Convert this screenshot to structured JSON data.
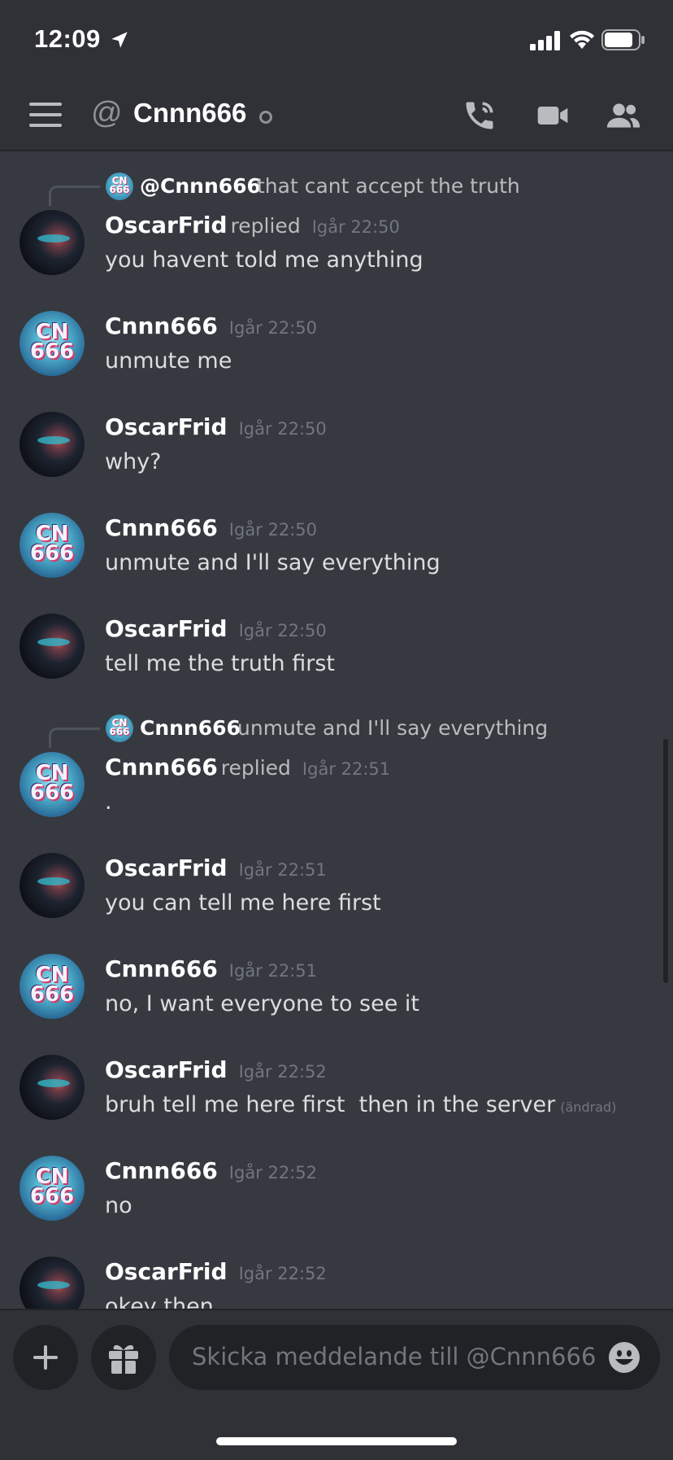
{
  "status_bar": {
    "time": "12:09"
  },
  "header": {
    "channel_name": "Cnnn666",
    "prefix": "@"
  },
  "messages": [
    {
      "reply": {
        "name": "@Cnnn666",
        "text": "that cant accept the truth"
      },
      "author": "OscarFrid",
      "replied": "replied",
      "time": "Igår 22:50",
      "text": "you havent told me anything",
      "avatar": "oscar"
    },
    {
      "author": "Cnnn666",
      "time": "Igår 22:50",
      "text": "unmute me",
      "avatar": "cnnn"
    },
    {
      "author": "OscarFrid",
      "time": "Igår 22:50",
      "text": "why?",
      "avatar": "oscar"
    },
    {
      "author": "Cnnn666",
      "time": "Igår 22:50",
      "text": "unmute and I'll say everything",
      "avatar": "cnnn"
    },
    {
      "author": "OscarFrid",
      "time": "Igår 22:50",
      "text": "tell me the truth first",
      "avatar": "oscar"
    },
    {
      "reply": {
        "name": "Cnnn666",
        "text": "unmute and I'll say everything"
      },
      "author": "Cnnn666",
      "replied": "replied",
      "time": "Igår 22:51",
      "text": ".",
      "avatar": "cnnn"
    },
    {
      "author": "OscarFrid",
      "time": "Igår 22:51",
      "text": "you can tell me here first",
      "avatar": "oscar"
    },
    {
      "author": "Cnnn666",
      "time": "Igår 22:51",
      "text": "no, I want everyone to see it",
      "avatar": "cnnn"
    },
    {
      "author": "OscarFrid",
      "time": "Igår 22:52",
      "text": "bruh tell me here first  then in the server",
      "edited": "(ändrad)",
      "avatar": "oscar"
    },
    {
      "author": "Cnnn666",
      "time": "Igår 22:52",
      "text": "no",
      "avatar": "cnnn"
    },
    {
      "author": "OscarFrid",
      "time": "Igår 22:52",
      "text": "okey then",
      "avatar": "oscar"
    }
  ],
  "composer": {
    "placeholder": "Skicka meddelande till @Cnnn666"
  },
  "avatar_glyph": "CN 666",
  "icons": [
    "menu-icon",
    "at-icon",
    "phone-icon",
    "video-icon",
    "members-icon",
    "plus-icon",
    "gift-icon",
    "emoji-icon"
  ],
  "colors": {
    "background": "#36393f",
    "header": "#2f3136",
    "input": "#202225",
    "muted": "#72767d"
  }
}
